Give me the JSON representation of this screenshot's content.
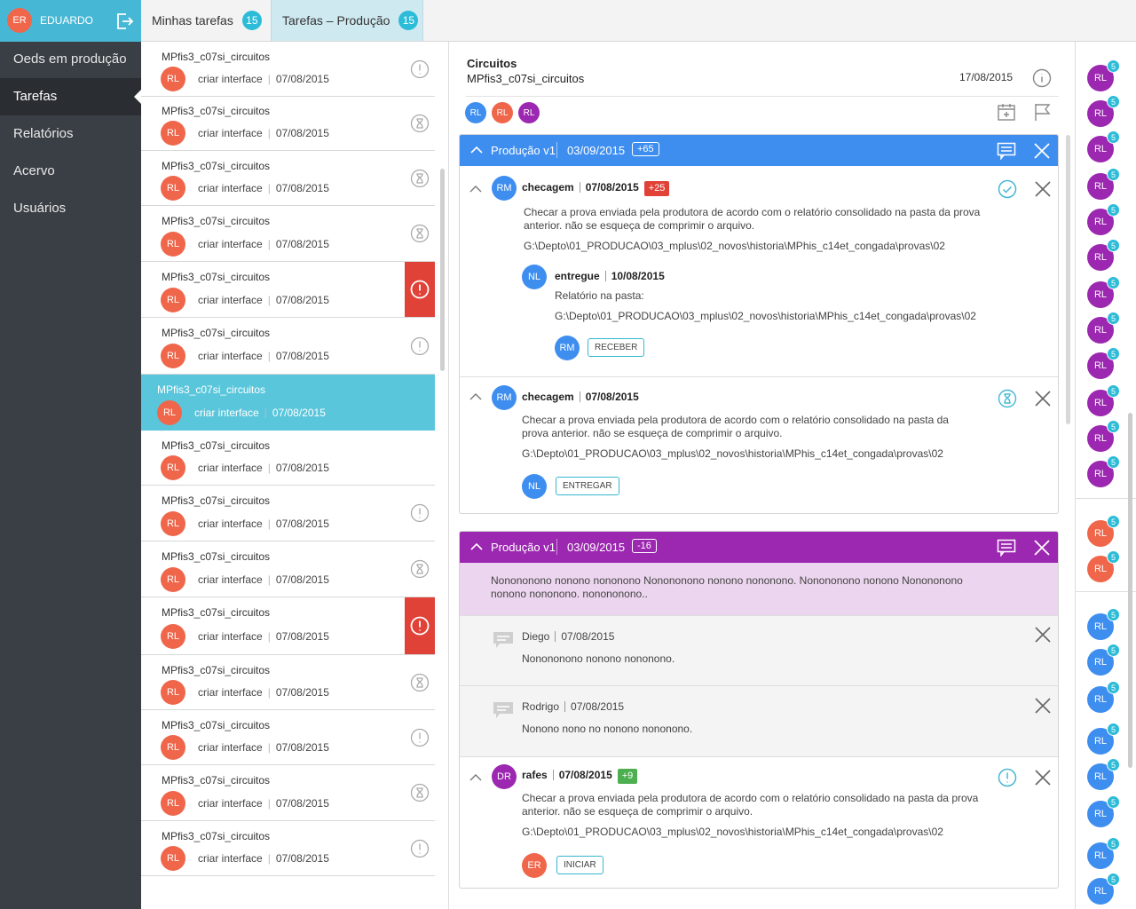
{
  "user": {
    "initials": "ER",
    "name": "EDUARDO"
  },
  "sidebar": {
    "items": [
      {
        "label": "Oeds em produção"
      },
      {
        "label": "Tarefas"
      },
      {
        "label": "Relatórios"
      },
      {
        "label": "Acervo"
      },
      {
        "label": "Usuários"
      }
    ]
  },
  "tabs": [
    {
      "label": "Minhas tarefas",
      "count": "15"
    },
    {
      "label": "Tarefas – Produção",
      "count": "15"
    }
  ],
  "tasks": [
    {
      "title": "MPfis3_c07si_circuitos",
      "initials": "RL",
      "action": "criar interface",
      "date": "07/08/2015",
      "status": "warning-icon"
    },
    {
      "title": "MPfis3_c07si_circuitos",
      "initials": "RL",
      "action": "criar interface",
      "date": "07/08/2015",
      "status": "hourglass-icon"
    },
    {
      "title": "MPfis3_c07si_circuitos",
      "initials": "RL",
      "action": "criar interface",
      "date": "07/08/2015",
      "status": "hourglass-icon"
    },
    {
      "title": "MPfis3_c07si_circuitos",
      "initials": "RL",
      "action": "criar interface",
      "date": "07/08/2015",
      "status": "hourglass-icon"
    },
    {
      "title": "MPfis3_c07si_circuitos",
      "initials": "RL",
      "action": "criar interface",
      "date": "07/08/2015",
      "status": "alert-icon"
    },
    {
      "title": "MPfis3_c07si_circuitos",
      "initials": "RL",
      "action": "criar interface",
      "date": "07/08/2015",
      "status": "warning-icon"
    },
    {
      "title": "MPfis3_c07si_circuitos",
      "initials": "RL",
      "action": "criar interface",
      "date": "07/08/2015",
      "status": "selected"
    },
    {
      "title": "MPfis3_c07si_circuitos",
      "initials": "RL",
      "action": "criar interface",
      "date": "07/08/2015",
      "status": "none"
    },
    {
      "title": "MPfis3_c07si_circuitos",
      "initials": "RL",
      "action": "criar interface",
      "date": "07/08/2015",
      "status": "warning-icon"
    },
    {
      "title": "MPfis3_c07si_circuitos",
      "initials": "RL",
      "action": "criar interface",
      "date": "07/08/2015",
      "status": "hourglass-icon"
    },
    {
      "title": "MPfis3_c07si_circuitos",
      "initials": "RL",
      "action": "criar interface",
      "date": "07/08/2015",
      "status": "alert-icon"
    },
    {
      "title": "MPfis3_c07si_circuitos",
      "initials": "RL",
      "action": "criar interface",
      "date": "07/08/2015",
      "status": "hourglass-icon"
    },
    {
      "title": "MPfis3_c07si_circuitos",
      "initials": "RL",
      "action": "criar interface",
      "date": "07/08/2015",
      "status": "warning-icon"
    },
    {
      "title": "MPfis3_c07si_circuitos",
      "initials": "RL",
      "action": "criar interface",
      "date": "07/08/2015",
      "status": "hourglass-icon"
    },
    {
      "title": "MPfis3_c07si_circuitos",
      "initials": "RL",
      "action": "criar interface",
      "date": "07/08/2015",
      "status": "warning-icon"
    }
  ],
  "detail": {
    "title": "Circuitos",
    "subtitle": "MPfis3_c07si_circuitos",
    "date": "17/08/2015",
    "members": [
      "RL",
      "RL",
      "RL"
    ],
    "card1": {
      "label": "Produção v1",
      "date": "03/09/2015",
      "badge": "+65",
      "color": "#3e8ef0",
      "item1": {
        "initials": "RM",
        "name": "checagem",
        "date": "07/08/2015",
        "tag": "+25",
        "text": "Checar a prova enviada pela produtora de acordo com o relatório consolidado na pasta da prova anterior. não se esqueça de comprimir o arquivo.",
        "path": "G:\\Depto\\01_PRODUCAO\\03_mplus\\02_novos\\historia\\MPhis_c14et_congada\\provas\\02",
        "reply": {
          "initials": "NL",
          "name": "entregue",
          "date": "10/08/2015",
          "text": "Relatório na pasta:",
          "path": "G:\\Depto\\01_PRODUCAO\\03_mplus\\02_novos\\historia\\MPhis_c14et_congada\\provas\\02",
          "actor": "RM",
          "button": "RECEBER"
        }
      },
      "item2": {
        "initials": "RM",
        "name": "checagem",
        "date": "07/08/2015",
        "text": "Checar a prova enviada pela produtora de acordo com o relatório consolidado na pasta da prova anterior. não se esqueça de comprimir o arquivo.",
        "path": "G:\\Depto\\01_PRODUCAO\\03_mplus\\02_novos\\historia\\MPhis_c14et_congada\\provas\\02",
        "actor": "NL",
        "button": "ENTREGAR"
      }
    },
    "card2": {
      "label": "Produção v1",
      "date": "03/09/2015",
      "badge": "-16",
      "color": "#9c27b0",
      "note": "Nonononono nonono nononono Nonononono nonono nononono. Nonononono nonono Nonononono nonono nononono. nonononono..",
      "comments": [
        {
          "author": "Diego",
          "date": "07/08/2015",
          "text": "Nonononono nonono nononono."
        },
        {
          "author": "Rodrigo",
          "date": "07/08/2015",
          "text": "Nonono nono no nonono nononono."
        }
      ],
      "item": {
        "initials": "DR",
        "name": "rafes",
        "date": "07/08/2015",
        "tag": "+9",
        "text": "Checar a prova enviada pela produtora de acordo com o relatório consolidado na pasta da prova anterior. não se esqueça de comprimir o arquivo.",
        "path": "G:\\Depto\\01_PRODUCAO\\03_mplus\\02_novos\\historia\\MPhis_c14et_congada\\provas\\02",
        "actor": "ER",
        "button": "INICIAR"
      }
    }
  },
  "rail": {
    "badge": "5",
    "groups": [
      {
        "color": "purple",
        "items": [
          "RL",
          "RL",
          "RL",
          "RL",
          "RL",
          "RL",
          "RL",
          "RL",
          "RL",
          "RL",
          "RL",
          "RL"
        ]
      },
      {
        "color": "orange",
        "items": [
          "RL",
          "RL"
        ]
      },
      {
        "color": "blue",
        "items": [
          "RL",
          "RL",
          "RL",
          "RL",
          "RL",
          "RL",
          "RL",
          "RL"
        ]
      }
    ]
  },
  "colors": {
    "accent": "#46b8d6",
    "blue": "#3e8ef0",
    "purple": "#9c27b0",
    "orange": "#f0664a",
    "alert": "#e04238",
    "green": "#4caf50",
    "red": "#e04238"
  }
}
